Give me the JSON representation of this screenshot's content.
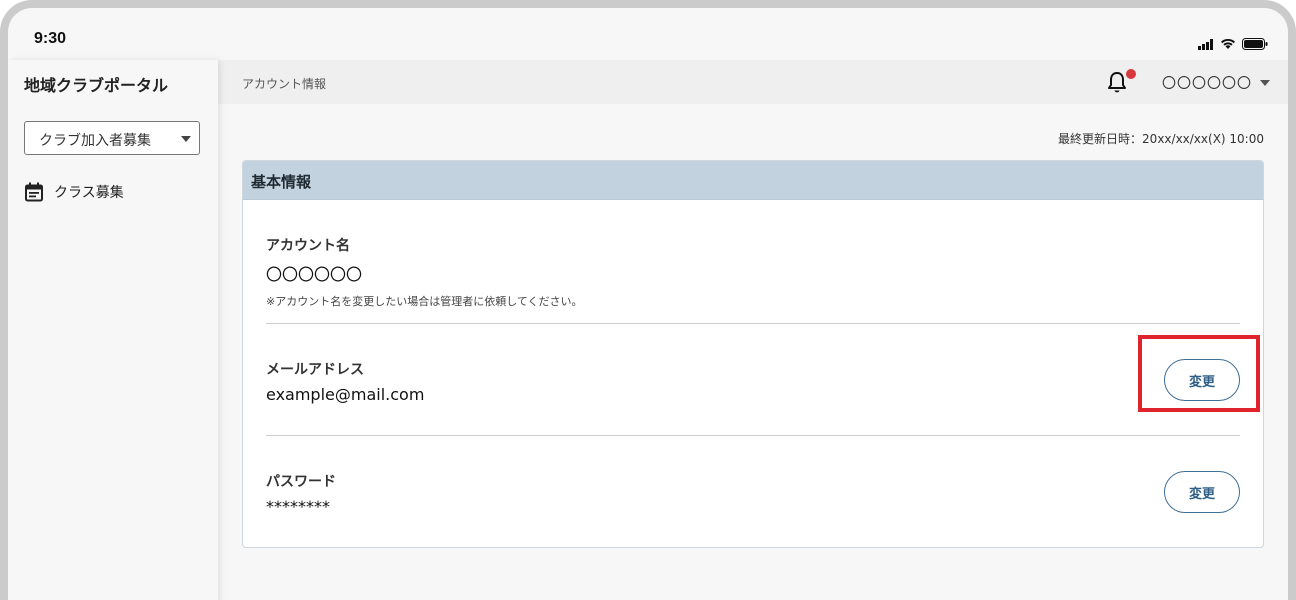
{
  "status_bar": {
    "time": "9:30"
  },
  "app": {
    "title": "地域クラブポータル"
  },
  "sidebar": {
    "club_select": {
      "value": "クラブ加入者募集"
    },
    "items": [
      {
        "label": "クラス募集",
        "icon": "calendar-icon"
      }
    ]
  },
  "topbar": {
    "breadcrumb": "アカウント情報",
    "user_name": "〇〇〇〇〇〇",
    "notification_dot_color": "#d9363e"
  },
  "updated_at": "最終更新日時：20xx/xx/xx(X) 10:00",
  "card": {
    "title": "基本情報",
    "account": {
      "label": "アカウント名",
      "value": "〇〇〇〇〇〇",
      "note": "※アカウント名を変更したい場合は管理者に依頼してください。"
    },
    "email": {
      "label": "メールアドレス",
      "value": "example@mail.com",
      "button": "変更"
    },
    "password": {
      "label": "パスワード",
      "value": "********",
      "button": "変更"
    }
  },
  "colors": {
    "accent": "#2f5f88",
    "card_header": "#c2d2de",
    "highlight": "#e0242e"
  }
}
